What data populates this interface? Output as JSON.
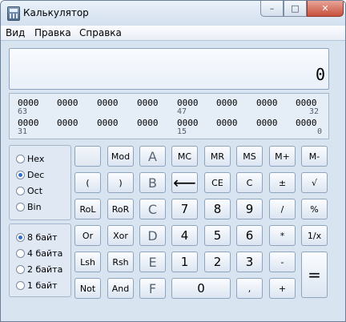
{
  "window": {
    "title": "Калькулятор",
    "controls": {
      "minimize": "–",
      "maximize": "□",
      "close": "✕"
    }
  },
  "menu": [
    "Вид",
    "Правка",
    "Справка"
  ],
  "display": {
    "value": "0"
  },
  "bits": {
    "row1": [
      "0000",
      "0000",
      "0000",
      "0000",
      "0000",
      "0000",
      "0000",
      "0000"
    ],
    "row1_idx": [
      "63",
      "47",
      "32"
    ],
    "row2": [
      "0000",
      "0000",
      "0000",
      "0000",
      "0000",
      "0000",
      "0000",
      "0000"
    ],
    "row2_idx": [
      "31",
      "15",
      "0"
    ]
  },
  "radix": {
    "options": [
      "Hex",
      "Dec",
      "Oct",
      "Bin"
    ],
    "selected": "Dec"
  },
  "word_size": {
    "options": [
      "8 байт",
      "4 байта",
      "2 байта",
      "1 байт"
    ],
    "selected": "8 байт"
  },
  "keys": {
    "mod": "Mod",
    "paren_open": "(",
    "paren_close": ")",
    "rol": "RoL",
    "ror": "RoR",
    "or": "Or",
    "xor": "Xor",
    "lsh": "Lsh",
    "rsh": "Rsh",
    "not": "Not",
    "and": "And",
    "a": "A",
    "b": "B",
    "c_hex": "C",
    "d": "D",
    "e": "E",
    "f": "F",
    "mc": "MC",
    "mr": "MR",
    "ms": "MS",
    "mplus": "M+",
    "mminus": "M-",
    "backspace": "⟵",
    "ce": "CE",
    "clear": "C",
    "plusminus": "±",
    "sqrt": "√",
    "n7": "7",
    "n8": "8",
    "n9": "9",
    "divide": "/",
    "percent": "%",
    "n4": "4",
    "n5": "5",
    "n6": "6",
    "multiply": "*",
    "reciprocal": "1/x",
    "n1": "1",
    "n2": "2",
    "n3": "3",
    "minus": "-",
    "equals": "=",
    "n0": "0",
    "decimal": ",",
    "plus": "+"
  }
}
